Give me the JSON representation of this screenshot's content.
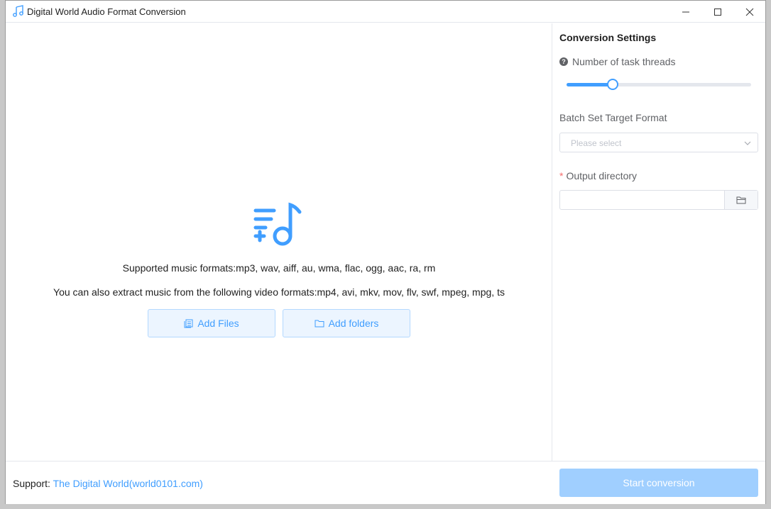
{
  "window": {
    "title": "Digital World Audio Format Conversion"
  },
  "main": {
    "supported_music": "Supported music formats:mp3, wav, aiff, au, wma, flac, ogg, aac, ra, rm",
    "supported_video": "You can also extract music from the following video formats:mp4, avi, mkv, mov, flv, swf, mpeg, mpg, ts",
    "add_files_label": "Add Files",
    "add_folders_label": "Add folders"
  },
  "settings": {
    "title": "Conversion Settings",
    "threads_label": "Number of task threads",
    "threads_level": 0.25,
    "format_label": "Batch Set Target Format",
    "format_placeholder": "Please select",
    "output_label": "Output directory",
    "output_value": ""
  },
  "footer": {
    "support_label": "Support:",
    "support_link": "The Digital World(world0101.com)",
    "start_label": "Start conversion"
  },
  "colors": {
    "accent": "#409eff",
    "accent_light": "#ecf5ff",
    "disabled_primary": "#a0cfff",
    "required": "#f56c6c"
  },
  "icons": {
    "app": "music-note-icon",
    "drop": "music-list-add-icon",
    "files": "document-copy-icon",
    "folders": "folder-icon",
    "help": "question-circle-icon",
    "dropdown": "chevron-down-icon",
    "browse": "folder-open-icon"
  }
}
